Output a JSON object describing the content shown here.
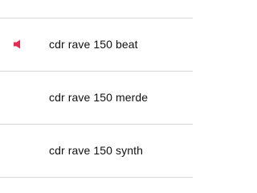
{
  "colors": {
    "accent": "#e32c54",
    "divider": "#d6d6d6",
    "text": "#111111"
  },
  "tracks": [
    {
      "title": "cdr rave 150 beat",
      "playing": true,
      "icon": "speaker-icon"
    },
    {
      "title": "cdr rave 150 merde",
      "playing": false
    },
    {
      "title": "cdr rave 150 synth",
      "playing": false
    }
  ]
}
